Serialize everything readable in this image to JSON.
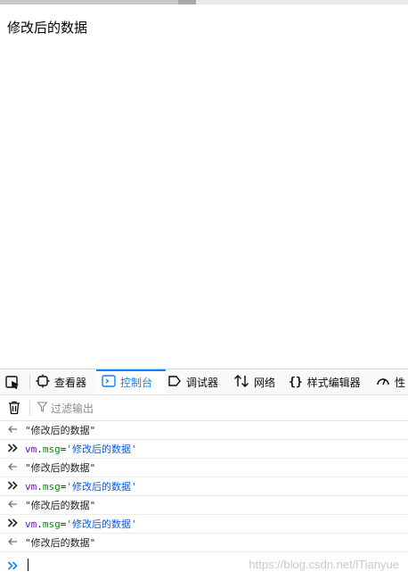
{
  "page": {
    "text": "修改后的数据"
  },
  "devtools": {
    "tabs": [
      {
        "label": "查看器",
        "icon": "inspector-icon"
      },
      {
        "label": "控制台",
        "icon": "console-icon",
        "selected": true
      },
      {
        "label": "调试器",
        "icon": "debugger-icon"
      },
      {
        "label": "网络",
        "icon": "network-icon"
      },
      {
        "label": "样式编辑器",
        "icon": "style-editor-icon"
      },
      {
        "label": "性",
        "icon": "performance-icon"
      }
    ],
    "toolbar": {
      "filter_placeholder": "过滤输出"
    },
    "console": {
      "rows": [
        {
          "type": "result",
          "text": "\"修改后的数据\""
        },
        {
          "type": "input",
          "obj": "vm",
          "prop": "msg",
          "value": "'修改后的数据'"
        },
        {
          "type": "result",
          "text": "\"修改后的数据\""
        },
        {
          "type": "input",
          "obj": "vm",
          "prop": "msg",
          "value": "'修改后的数据'"
        },
        {
          "type": "result",
          "text": "\"修改后的数据\""
        },
        {
          "type": "input",
          "obj": "vm",
          "prop": "msg",
          "value": "'修改后的数据'"
        },
        {
          "type": "result",
          "text": "\"修改后的数据\""
        }
      ]
    }
  },
  "watermark": "https://blog.csdn.net/lTianyue",
  "colors": {
    "accent": "#0a84ff",
    "keyword": "#8000d7",
    "property": "#058b00",
    "string": "#0b5bd3"
  }
}
